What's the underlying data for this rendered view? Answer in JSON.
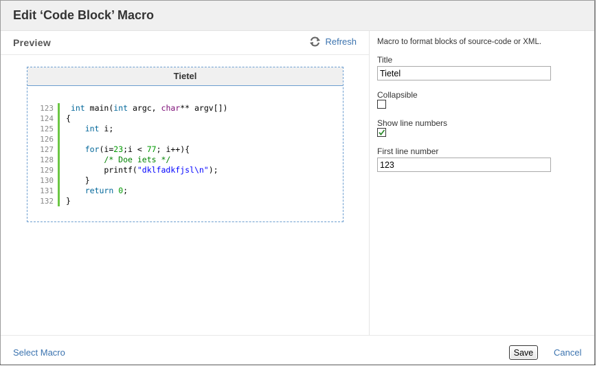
{
  "dialog": {
    "title": "Edit ‘Code Block’ Macro"
  },
  "preview": {
    "label": "Preview",
    "refresh_label": "Refresh",
    "code_title": "Tietel",
    "lines": [
      {
        "num": "123",
        "text": " int main(int argc, char** argv[])"
      },
      {
        "num": "124",
        "text": "{"
      },
      {
        "num": "125",
        "text": "    int i;"
      },
      {
        "num": "126",
        "text": ""
      },
      {
        "num": "127",
        "text": "    for(i=23;i < 77; i++){"
      },
      {
        "num": "128",
        "text": "        /* Doe iets */"
      },
      {
        "num": "129",
        "text": "        printf(\"dklfadkfjsl\\n\");"
      },
      {
        "num": "130",
        "text": "    }"
      },
      {
        "num": "131",
        "text": "    return 0;"
      },
      {
        "num": "132",
        "text": "}"
      }
    ]
  },
  "form": {
    "description": "Macro to format blocks of source-code or XML.",
    "title_label": "Title",
    "title_value": "Tietel",
    "collapsible_label": "Collapsible",
    "collapsible_checked": false,
    "line_numbers_label": "Show line numbers",
    "line_numbers_checked": true,
    "first_line_label": "First line number",
    "first_line_value": "123"
  },
  "footer": {
    "select_macro_label": "Select Macro",
    "save_label": "Save",
    "cancel_label": "Cancel"
  },
  "colors": {
    "link": "#3b73af",
    "gutter": "#6cc644",
    "border_dashed": "#6a9ccf"
  },
  "icons": {
    "refresh": "refresh-icon",
    "check": "checkmark-icon"
  }
}
